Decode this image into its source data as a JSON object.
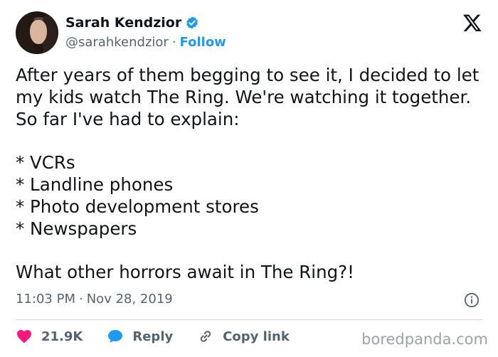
{
  "user": {
    "name": "Sarah Kendzior",
    "handle": "@sarahkendzior",
    "separator": "·",
    "follow_label": "Follow"
  },
  "tweet": {
    "text": "After years of them begging to see it, I decided to let my kids watch The Ring. We're watching it together. So far I've had to explain:\n\n* VCRs\n* Landline phones\n* Photo development stores\n* Newspapers\n\nWhat other horrors await in The Ring?!",
    "time": "11:03 PM",
    "separator": "·",
    "date": "Nov 28, 2019"
  },
  "actions": {
    "likes": "21.9K",
    "reply_label": "Reply",
    "copy_label": "Copy link"
  },
  "watermark": "boredpanda.com",
  "colors": {
    "accent": "#1d9bf0",
    "like": "#f91880",
    "text": "#0f1419",
    "muted": "#536471"
  },
  "icons": {
    "verified": "verified-badge-icon",
    "logo": "x-logo-icon",
    "info": "info-icon",
    "like": "heart-icon",
    "reply": "speech-bubble-icon",
    "copy": "link-icon"
  }
}
